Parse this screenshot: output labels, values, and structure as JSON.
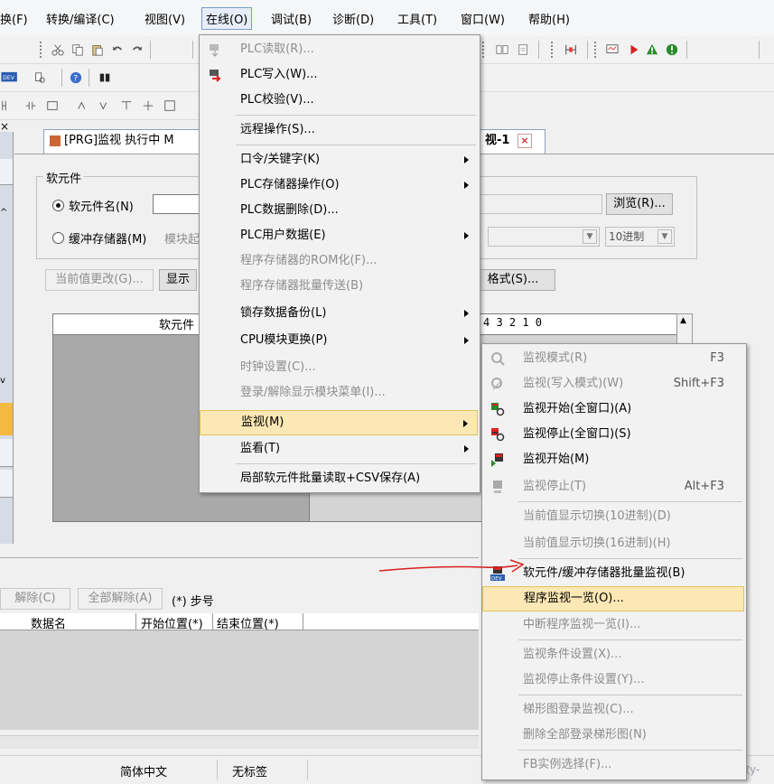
{
  "menubar": {
    "items": [
      {
        "label": "换(F)"
      },
      {
        "label": "转换/编译(C)"
      },
      {
        "label": "视图(V)"
      },
      {
        "label": "在线(O)"
      },
      {
        "label": "调试(B)"
      },
      {
        "label": "诊断(D)"
      },
      {
        "label": "工具(T)"
      },
      {
        "label": "窗口(W)"
      },
      {
        "label": "帮助(H)"
      }
    ]
  },
  "tabs": {
    "active": "[PRG]监视 执行中 M",
    "secondary": "视-1"
  },
  "device_panel": {
    "group_title": "软元件",
    "radio_device_label": "软元件名(N)",
    "radio_buffer_label": "缓冲存储器(M)",
    "module_label": "模块起",
    "browse_button": "浏览(R)...",
    "radix_value": "10进制",
    "current_value_button": "当前值更改(G)...",
    "display_button": "显示",
    "format_button": "格式(S)...",
    "grid_header": "软元件",
    "bit_header": "4 3 2 1 0"
  },
  "online_menu": {
    "items": [
      {
        "label": "PLC读取(R)...",
        "disabled": true
      },
      {
        "label": "PLC写入(W)..."
      },
      {
        "label": "PLC校验(V)..."
      },
      {
        "label": "远程操作(S)..."
      },
      {
        "label": "口令/关键字(K)",
        "submenu": true
      },
      {
        "label": "PLC存储器操作(O)",
        "submenu": true
      },
      {
        "label": "PLC数据删除(D)..."
      },
      {
        "label": "PLC用户数据(E)",
        "submenu": true
      },
      {
        "label": "程序存储器的ROM化(F)...",
        "disabled": true
      },
      {
        "label": "程序存储器批量传送(B)",
        "disabled": true
      },
      {
        "label": "锁存数据备份(L)",
        "submenu": true
      },
      {
        "label": "CPU模块更换(P)",
        "submenu": true
      },
      {
        "label": "时钟设置(C)...",
        "disabled": true
      },
      {
        "label": "登录/解除显示模块菜单(I)...",
        "disabled": true
      },
      {
        "label": "监视(M)",
        "submenu": true,
        "highlighted": true
      },
      {
        "label": "监看(T)",
        "submenu": true
      },
      {
        "label": "局部软元件批量读取+CSV保存(A)"
      }
    ]
  },
  "monitor_menu": {
    "items": [
      {
        "label": "监视模式(R)",
        "shortcut": "F3",
        "disabled": true
      },
      {
        "label": "监视(写入模式)(W)",
        "shortcut": "Shift+F3",
        "disabled": true
      },
      {
        "label": "监视开始(全窗口)(A)"
      },
      {
        "label": "监视停止(全窗口)(S)"
      },
      {
        "label": "监视开始(M)"
      },
      {
        "label": "监视停止(T)",
        "shortcut": "Alt+F3",
        "disabled": true
      },
      {
        "label": "当前值显示切换(10进制)(D)",
        "disabled": true
      },
      {
        "label": "当前值显示切换(16进制)(H)",
        "disabled": true
      },
      {
        "label": "软元件/缓冲存储器批量监视(B)"
      },
      {
        "label": "程序监视一览(O)...",
        "highlighted": true
      },
      {
        "label": "中断程序监视一览(I)...",
        "disabled": true
      },
      {
        "label": "监视条件设置(X)...",
        "disabled": true
      },
      {
        "label": "监视停止条件设置(Y)...",
        "disabled": true
      },
      {
        "label": "梯形图登录监视(C)...",
        "disabled": true
      },
      {
        "label": "删除全部登录梯形图(N)",
        "disabled": true
      },
      {
        "label": "FB实例选择(F)...",
        "disabled": true
      }
    ]
  },
  "bottom_panel": {
    "release_button": "解除(C)",
    "release_all_button": "全部解除(A)",
    "step_label": "(*) 步号",
    "col_data_name": "数据名",
    "col_start": "开始位置(*)",
    "col_end": "结束位置(*)"
  },
  "statusbar": {
    "language": "简体中文",
    "label": "无标签",
    "watermark": "CSDN @数y-"
  },
  "colors": {
    "menu_highlight": "#fce8b4",
    "annotation_arrow": "#d92020",
    "disabled_text": "#8d8d8d"
  }
}
